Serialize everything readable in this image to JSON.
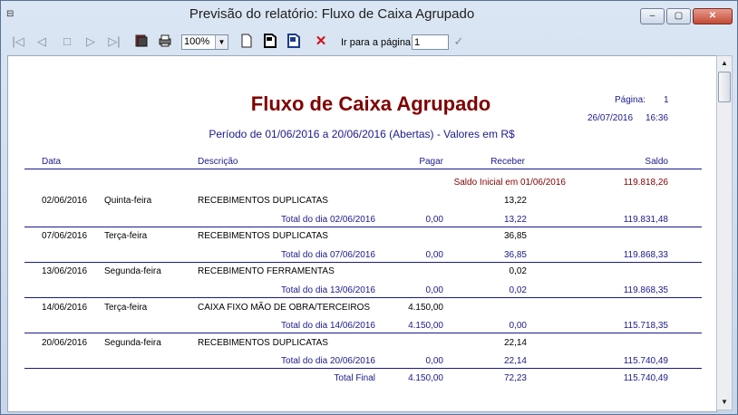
{
  "window": {
    "title": "Previsão do relatório: Fluxo de Caixa Agrupado",
    "min_label": "‒",
    "max_label": "▢",
    "close_label": "✕"
  },
  "toolbar": {
    "first_icon": "|◁",
    "prev_icon": "◁",
    "stop_icon": "□",
    "next_icon": "▷",
    "last_icon": "▷|",
    "zoom": "100%",
    "goto_label": "Ir para a página",
    "goto_value": "1",
    "confirm_icon": "✓"
  },
  "report": {
    "title": "Fluxo de Caixa Agrupado",
    "subtitle": "Período de 01/06/2016 a 20/06/2016 (Abertas) - Valores em R$",
    "page_label": "Página:",
    "page_number": "1",
    "date": "26/07/2016",
    "time": "16:36",
    "columns": {
      "data": "Data",
      "descricao": "Descrição",
      "pagar": "Pagar",
      "receber": "Receber",
      "saldo": "Saldo"
    },
    "saldo_inicial_label": "Saldo Inicial em 01/06/2016",
    "saldo_inicial_value": "119.818,26",
    "groups": [
      {
        "date": "02/06/2016",
        "weekday": "Quinta-feira",
        "desc": "RECEBIMENTOS DUPLICATAS",
        "pagar": "",
        "receber": "13,22",
        "total_label": "Total do dia 02/06/2016",
        "total_pagar": "0,00",
        "total_receber": "13,22",
        "total_saldo": "119.831,48"
      },
      {
        "date": "07/06/2016",
        "weekday": "Terça-feira",
        "desc": "RECEBIMENTOS DUPLICATAS",
        "pagar": "",
        "receber": "36,85",
        "total_label": "Total do dia 07/06/2016",
        "total_pagar": "0,00",
        "total_receber": "36,85",
        "total_saldo": "119.868,33"
      },
      {
        "date": "13/06/2016",
        "weekday": "Segunda-feira",
        "desc": "RECEBIMENTO FERRAMENTAS",
        "pagar": "",
        "receber": "0,02",
        "total_label": "Total do dia 13/06/2016",
        "total_pagar": "0,00",
        "total_receber": "0,02",
        "total_saldo": "119.868,35"
      },
      {
        "date": "14/06/2016",
        "weekday": "Terça-feira",
        "desc": "CAIXA FIXO MÃO DE OBRA/TERCEIROS",
        "pagar": "4.150,00",
        "receber": "",
        "total_label": "Total do dia 14/06/2016",
        "total_pagar": "4.150,00",
        "total_receber": "0,00",
        "total_saldo": "115.718,35"
      },
      {
        "date": "20/06/2016",
        "weekday": "Segunda-feira",
        "desc": "RECEBIMENTOS DUPLICATAS",
        "pagar": "",
        "receber": "22,14",
        "total_label": "Total do dia 20/06/2016",
        "total_pagar": "0,00",
        "total_receber": "22,14",
        "total_saldo": "115.740,49"
      }
    ],
    "total_final_label": "Total Final",
    "total_final_pagar": "4.150,00",
    "total_final_receber": "72,23",
    "total_final_saldo": "115.740,49"
  }
}
